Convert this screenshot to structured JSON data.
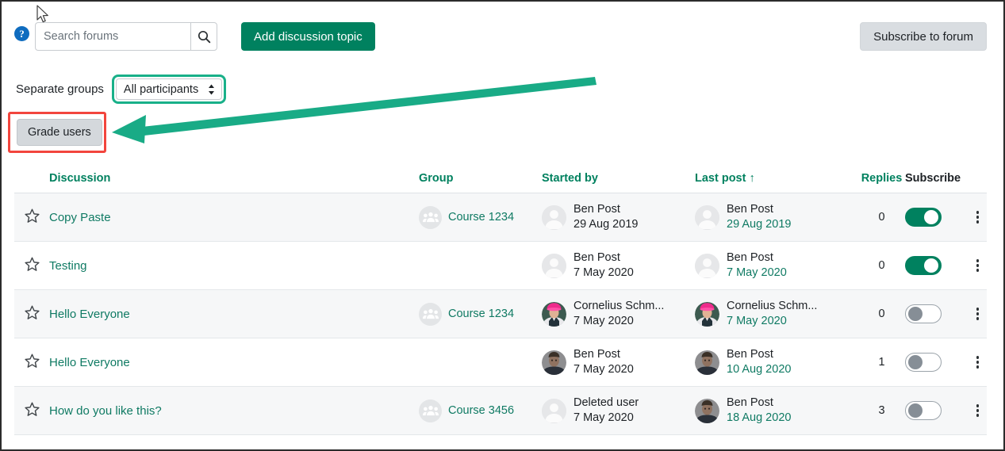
{
  "colors": {
    "brand_green": "#00815f",
    "link_green": "#0f7a63",
    "header_green": "#00815f",
    "highlight_red": "#f2453d",
    "annotation_green": "#19b089",
    "help_blue": "#0f6cbf",
    "secondary_button": "#d9dde1",
    "row_shade": "#f6f7f8"
  },
  "toolbar": {
    "help_icon": "help-icon",
    "help_glyph": "?",
    "search": {
      "placeholder": "Search forums",
      "value": "",
      "icon": "search-icon"
    },
    "add_topic_label": "Add discussion topic",
    "subscribe_forum_label": "Subscribe to forum"
  },
  "group_filter": {
    "mode_label": "Separate groups",
    "selected": "All participants",
    "options": [
      "All participants"
    ],
    "icon": "chevron-updown-icon"
  },
  "grade": {
    "button_label": "Grade users",
    "highlight": "red-highlight-box",
    "annotation": "green-arrow-pointing-left"
  },
  "table": {
    "headers": [
      {
        "key": "star",
        "label": "",
        "sortable": false
      },
      {
        "key": "discussion",
        "label": "Discussion",
        "sortable": true
      },
      {
        "key": "group",
        "label": "Group",
        "sortable": true
      },
      {
        "key": "started_by",
        "label": "Started by",
        "sortable": true
      },
      {
        "key": "last_post",
        "label": "Last post",
        "sortable": true,
        "sort_indicator": "↑"
      },
      {
        "key": "replies",
        "label": "Replies",
        "sortable": true
      },
      {
        "key": "subscribe",
        "label": "Subscribe",
        "sortable": false
      }
    ],
    "rows": [
      {
        "discussion": "Copy Paste",
        "group": "Course 1234",
        "has_group": true,
        "started_by_name": "Ben Post",
        "started_by_date": "29 Aug 2019",
        "started_by_avatar": "blank-avatar",
        "last_post_name": "Ben Post",
        "last_post_date": "29 Aug 2019",
        "last_post_avatar": "blank-avatar",
        "replies": "0",
        "subscribed": true,
        "shaded": true
      },
      {
        "discussion": "Testing",
        "group": "",
        "has_group": false,
        "started_by_name": "Ben Post",
        "started_by_date": "7 May 2020",
        "started_by_avatar": "blank-avatar",
        "last_post_name": "Ben Post",
        "last_post_date": "7 May 2020",
        "last_post_avatar": "blank-avatar",
        "replies": "0",
        "subscribed": true,
        "shaded": false
      },
      {
        "discussion": "Hello Everyone",
        "group": "Course 1234",
        "has_group": true,
        "started_by_name": "Cornelius Schm...",
        "started_by_date": "7 May 2020",
        "started_by_avatar": "photo-pink-hat",
        "last_post_name": "Cornelius Schm...",
        "last_post_date": "7 May 2020",
        "last_post_avatar": "photo-pink-hat",
        "replies": "0",
        "subscribed": false,
        "shaded": true
      },
      {
        "discussion": "Hello Everyone",
        "group": "",
        "has_group": false,
        "started_by_name": "Ben Post",
        "started_by_date": "7 May 2020",
        "started_by_avatar": "photo-man",
        "last_post_name": "Ben Post",
        "last_post_date": "10 Aug 2020",
        "last_post_avatar": "photo-man",
        "replies": "1",
        "subscribed": false,
        "shaded": false
      },
      {
        "discussion": "How do you like this?",
        "group": "Course 3456",
        "has_group": true,
        "started_by_name": "Deleted user",
        "started_by_date": "7 May 2020",
        "started_by_avatar": "blank-avatar",
        "last_post_name": "Ben Post",
        "last_post_date": "18 Aug 2020",
        "last_post_avatar": "photo-man",
        "replies": "3",
        "subscribed": false,
        "shaded": true
      }
    ]
  }
}
